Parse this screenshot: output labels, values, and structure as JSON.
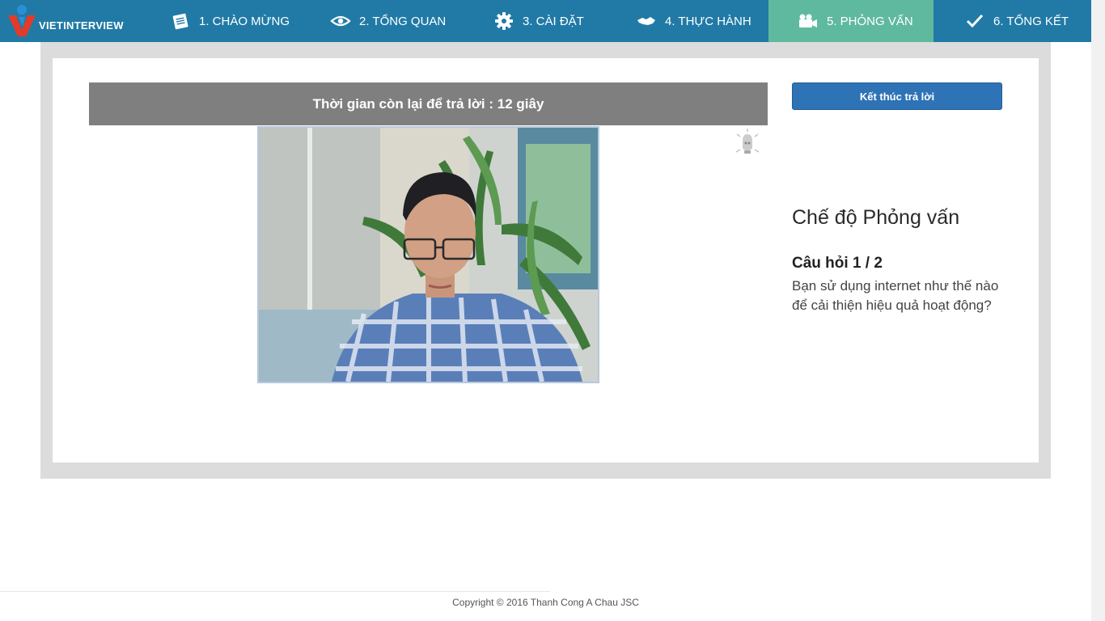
{
  "brand": {
    "name": "VIETINTERVIEW"
  },
  "nav": {
    "items": [
      {
        "label": "1. CHÀO MỪNG",
        "icon": "notepad-icon"
      },
      {
        "label": "2. TỔNG QUAN",
        "icon": "eye-icon"
      },
      {
        "label": "3. CÀI ĐẶT",
        "icon": "gear-icon"
      },
      {
        "label": "4. THỰC HÀNH",
        "icon": "handshake-icon"
      },
      {
        "label": "5. PHỎNG VẤN",
        "icon": "video-camera-icon",
        "active": true
      },
      {
        "label": "6. TỔNG KẾT",
        "icon": "checkmark-icon"
      }
    ]
  },
  "timer": {
    "text": "Thời gian còn lại để trả lời : 12 giây"
  },
  "actions": {
    "end_answer_label": "Kết thúc trả lời"
  },
  "interview": {
    "mode_title": "Chế độ Phỏng vấn",
    "question_number": "Câu hỏi 1 / 2",
    "question_text": "Bạn sử dụng internet như thế nào để cải thiện hiệu quả hoạt động?"
  },
  "footer": {
    "copyright": "Copyright © 2016 Thanh Cong A Chau JSC"
  },
  "colors": {
    "nav_bg": "#217aa6",
    "nav_active": "#5fb99e",
    "button": "#2e73b5",
    "timer_bar": "#7f7f7f"
  }
}
